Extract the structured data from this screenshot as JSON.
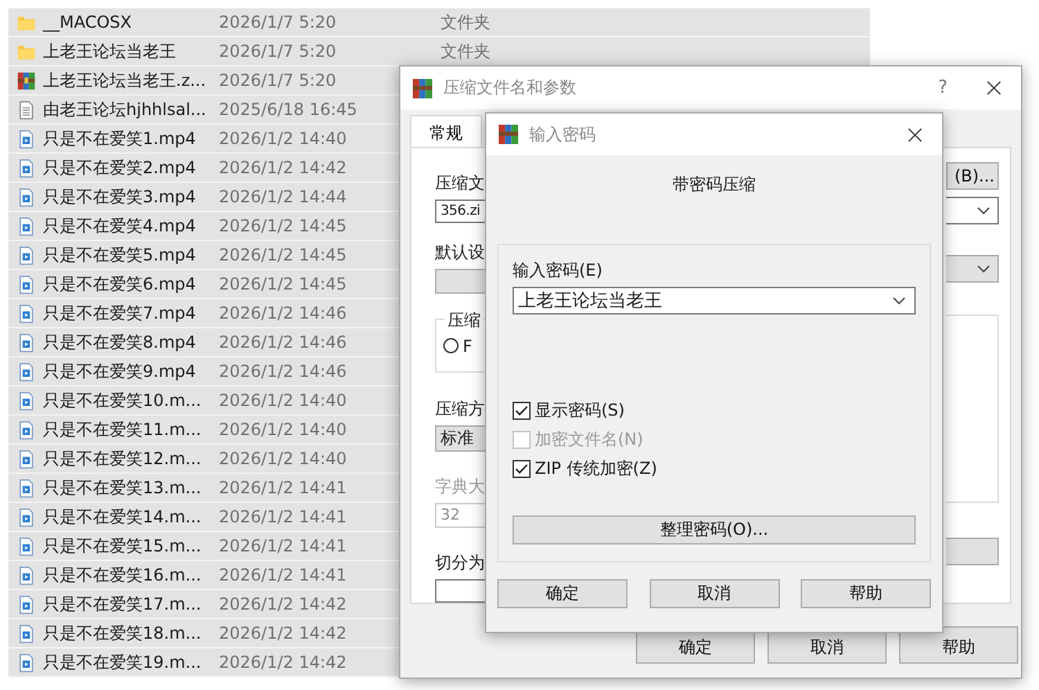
{
  "file_list": {
    "rows": [
      {
        "kind": "folder",
        "name": "__MACOSX",
        "date": "2026/1/7 5:20",
        "type": "文件夹",
        "selected": true
      },
      {
        "kind": "folder",
        "name": "上老王论坛当老王",
        "date": "2026/1/7 5:20",
        "type": "文件夹",
        "selected": true
      },
      {
        "kind": "archive",
        "name": "上老王论坛当老王.z...",
        "date": "2026/1/7 5:20",
        "selected": true
      },
      {
        "kind": "document",
        "name": "由老王论坛hjhhlsal...",
        "date": "2025/6/18 16:45",
        "selected": true
      },
      {
        "kind": "video",
        "name": "只是不在爱笑1.mp4",
        "date": "2026/1/2 14:40",
        "selected": true
      },
      {
        "kind": "video",
        "name": "只是不在爱笑2.mp4",
        "date": "2026/1/2 14:42",
        "selected": true
      },
      {
        "kind": "video",
        "name": "只是不在爱笑3.mp4",
        "date": "2026/1/2 14:44",
        "selected": true
      },
      {
        "kind": "video",
        "name": "只是不在爱笑4.mp4",
        "date": "2026/1/2 14:45",
        "selected": true
      },
      {
        "kind": "video",
        "name": "只是不在爱笑5.mp4",
        "date": "2026/1/2 14:45",
        "selected": true
      },
      {
        "kind": "video",
        "name": "只是不在爱笑6.mp4",
        "date": "2026/1/2 14:45",
        "selected": true
      },
      {
        "kind": "video",
        "name": "只是不在爱笑7.mp4",
        "date": "2026/1/2 14:46",
        "selected": true
      },
      {
        "kind": "video",
        "name": "只是不在爱笑8.mp4",
        "date": "2026/1/2 14:46",
        "selected": true
      },
      {
        "kind": "video",
        "name": "只是不在爱笑9.mp4",
        "date": "2026/1/2 14:46",
        "selected": true
      },
      {
        "kind": "video",
        "name": "只是不在爱笑10.m...",
        "date": "2026/1/2 14:40",
        "selected": true
      },
      {
        "kind": "video",
        "name": "只是不在爱笑11.m...",
        "date": "2026/1/2 14:40",
        "selected": true
      },
      {
        "kind": "video",
        "name": "只是不在爱笑12.m...",
        "date": "2026/1/2 14:40",
        "selected": true
      },
      {
        "kind": "video",
        "name": "只是不在爱笑13.m...",
        "date": "2026/1/2 14:41",
        "selected": true
      },
      {
        "kind": "video",
        "name": "只是不在爱笑14.m...",
        "date": "2026/1/2 14:41",
        "selected": true
      },
      {
        "kind": "video",
        "name": "只是不在爱笑15.m...",
        "date": "2026/1/2 14:41",
        "selected": true
      },
      {
        "kind": "video",
        "name": "只是不在爱笑16.m...",
        "date": "2026/1/2 14:41",
        "selected": true
      },
      {
        "kind": "video",
        "name": "只是不在爱笑17.m...",
        "date": "2026/1/2 14:42",
        "selected": true
      },
      {
        "kind": "video",
        "name": "只是不在爱笑18.m...",
        "date": "2026/1/2 14:42",
        "selected": true
      },
      {
        "kind": "video",
        "name": "只是不在爱笑19.m...",
        "date": "2026/1/2 14:42",
        "selected": true
      }
    ]
  },
  "archive_dialog": {
    "title": "压缩文件名和参数",
    "help": "?",
    "tabs": [
      {
        "label": "常规",
        "selected": true
      }
    ],
    "archive_name_label": "压缩文",
    "archive_name_value": "356.zi",
    "browse_button": "(B)...",
    "profile_label": "默认设",
    "format_group_label": "压缩",
    "format_radio": {
      "label": "F",
      "selected": false
    },
    "method_label": "压缩方",
    "method_value": "标准",
    "dictionary_label": "字典大",
    "dictionary_disabled": true,
    "dictionary_value": "32",
    "split_label": "切分为",
    "buttons": [
      "确定",
      "取消",
      "帮助"
    ]
  },
  "password_dialog": {
    "title": "输入密码",
    "heading": "带密码压缩",
    "password_label": "输入密码(E)",
    "password_value": "上老王论坛当老王",
    "options": [
      {
        "label": "显示密码(S)",
        "checked": true,
        "disabled": false
      },
      {
        "label": "加密文件名(N)",
        "checked": false,
        "disabled": true
      },
      {
        "label": "ZIP 传统加密(Z)",
        "checked": true,
        "disabled": false
      }
    ],
    "organize_button": "整理密码(O)...",
    "buttons": [
      "确定",
      "取消",
      "帮助"
    ]
  }
}
